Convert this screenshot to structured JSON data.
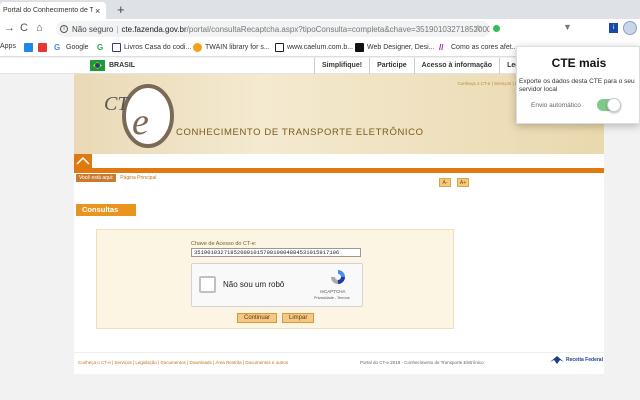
{
  "browser": {
    "tab": {
      "title": "Portal do Conhecimento de Transporte",
      "close": "×"
    },
    "new_tab": "+",
    "address": {
      "insecure_label": "Não seguro",
      "host": "cte.fazenda.gov.br",
      "path": "/portal/consultaRecaptcha.aspx?tipoConsulta=completa&chave=35190103271852000..."
    },
    "bookmarks": [
      {
        "label": "Apps",
        "icon": "apps-icon",
        "color": "#4285f4"
      },
      {
        "label": "",
        "icon": "bookmark-blue-icon",
        "color": "#1e88e5"
      },
      {
        "label": "",
        "icon": "bookmark-red-icon",
        "color": "#e53935"
      },
      {
        "label": "Google",
        "icon": "google-icon",
        "color": "#4285f4"
      },
      {
        "label": "",
        "icon": "google-g-icon",
        "color": "#34a853"
      },
      {
        "label": "Livros Casa do codi...",
        "icon": "bookmark-icon",
        "color": "#3a3a8a"
      },
      {
        "label": "TWAIN library for s...",
        "icon": "twain-icon",
        "color": "#f4a01a"
      },
      {
        "label": "www.caelum.com.b...",
        "icon": "caelum-icon",
        "color": "#222"
      },
      {
        "label": "Web Designer, Desi...",
        "icon": "webdesigner-icon",
        "color": "#111"
      },
      {
        "label": "Como as cores afet...",
        "icon": "colors-icon",
        "color": "#8e24aa"
      }
    ]
  },
  "gov_bar": {
    "country": "BRASIL",
    "links": [
      "Simplifique!",
      "Participe",
      "Acesso à informação",
      "Legislaç"
    ]
  },
  "site": {
    "top_nav": "Conheça o CT-e | Serviços | Legislação | Documentos | Downloads | Á",
    "logo_text": "CTe",
    "banner_title": "CONHECIMENTO DE TRANSPORTE ELETRÔNICO",
    "breadcrumb": {
      "here": "Você está aqui:",
      "link": "Página Principal"
    },
    "font_buttons": [
      "A-",
      "A+"
    ],
    "section_title": "Consultas",
    "form": {
      "key_label": "Chave de Acesso do CT-e:",
      "key_value": "35190103271852000101570010004884531015917106",
      "captcha_text": "Não sou um robô",
      "captcha_brand": "reCAPTCHA",
      "captcha_terms": "Privacidade - Termos",
      "continue_label": "Continuar",
      "clear_label": "Limpar"
    },
    "footer": {
      "links": "Conheça o CT-e | Serviços | Legislação | Documentos | Downloads | Área Restrita | Documentos e outros",
      "copyright": "Portal do CT-e 2019 - Conhecimento de Transporte Eletrônico",
      "agency": "Receita Federal"
    }
  },
  "extension_popup": {
    "title": "CTE mais",
    "description": "Exporte os dados desta CTE para o seu servidor local",
    "toggle_label": "Envio automático",
    "toggle_on": true,
    "toggle_color": "#7fc98a"
  },
  "colors": {
    "accent": "#e8941f",
    "banner_text": "#7a5a1e",
    "link": "#c47218"
  }
}
